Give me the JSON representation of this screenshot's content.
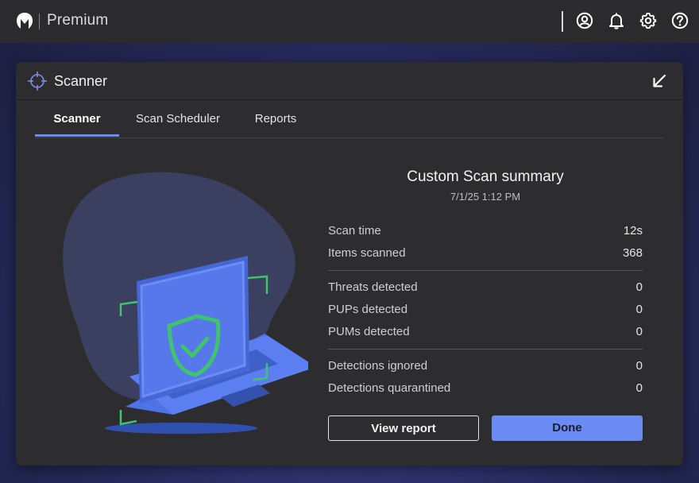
{
  "app": {
    "brand": "Premium",
    "logo_icon": "malwarebytes-logo-icon",
    "top_icons": [
      "account-icon",
      "bell-icon",
      "gear-icon",
      "help-icon"
    ]
  },
  "window": {
    "title": "Scanner",
    "title_icon": "crosshair-icon",
    "collapse_icon": "collapse-arrow-icon"
  },
  "tabs": [
    {
      "label": "Scanner",
      "active": true
    },
    {
      "label": "Scan Scheduler",
      "active": false
    },
    {
      "label": "Reports",
      "active": false
    }
  ],
  "summary": {
    "title": "Custom Scan summary",
    "date": "7/1/25 1:12 PM",
    "rows": [
      {
        "label": "Scan time",
        "value": "12s"
      },
      {
        "label": "Items scanned",
        "value": "368"
      },
      {
        "label": "Threats detected",
        "value": "0"
      },
      {
        "label": "PUPs detected",
        "value": "0"
      },
      {
        "label": "PUMs detected",
        "value": "0"
      },
      {
        "label": "Detections ignored",
        "value": "0"
      },
      {
        "label": "Detections quarantined",
        "value": "0"
      }
    ]
  },
  "buttons": {
    "view_report": "View report",
    "done": "Done"
  },
  "colors": {
    "accent": "#6a8bf3",
    "shield_green": "#3ec46d",
    "panel_bg": "#2d2d2f",
    "topbar_bg": "#2b2b2d"
  }
}
